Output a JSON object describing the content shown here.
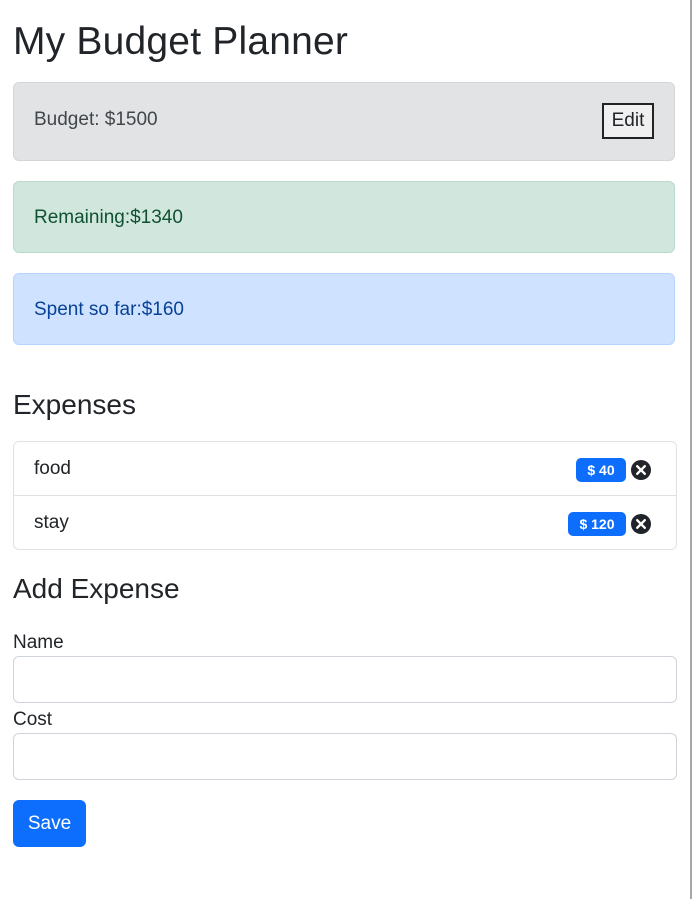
{
  "page_title": "My Budget Planner",
  "budget": {
    "text": "Budget: $1500",
    "edit_label": "Edit"
  },
  "remaining": {
    "text": "Remaining:$1340"
  },
  "spent": {
    "text": "Spent so far:$160"
  },
  "expenses": {
    "heading": "Expenses",
    "items": [
      {
        "name": "food",
        "cost": "$ 40"
      },
      {
        "name": "stay",
        "cost": "$ 120"
      }
    ]
  },
  "add_expense": {
    "heading": "Add Expense",
    "name_label": "Name",
    "name_value": "",
    "cost_label": "Cost",
    "cost_value": "",
    "save_label": "Save"
  },
  "colors": {
    "primary": "#0d6efd",
    "budget_bg": "#e2e3e5",
    "remaining_bg": "#d1e7dd",
    "spent_bg": "#cfe2ff"
  },
  "icons": {
    "delete": "close-circle-icon"
  }
}
